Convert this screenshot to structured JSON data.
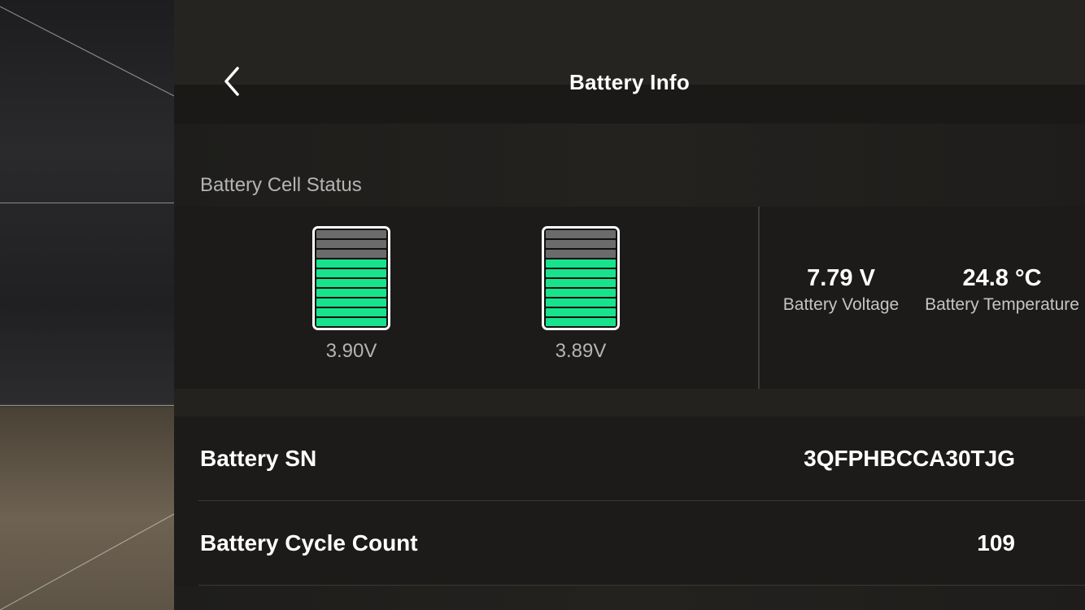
{
  "header": {
    "title": "Battery Info",
    "back_icon": "chevron-left-icon"
  },
  "cell_status": {
    "label": "Battery Cell Status",
    "cells": [
      {
        "voltage": "3.90V",
        "level_segments": 7,
        "total_segments": 10
      },
      {
        "voltage": "3.89V",
        "level_segments": 7,
        "total_segments": 10
      }
    ]
  },
  "stats": {
    "voltage": {
      "value": "7.79 V",
      "label": "Battery Voltage"
    },
    "temperature": {
      "value": "24.8 °C",
      "label": "Battery Temperature"
    }
  },
  "info_rows": [
    {
      "key": "Battery SN",
      "value": "3QFPHBCCA30TJG"
    },
    {
      "key": "Battery Cycle Count",
      "value": "109"
    }
  ],
  "colors": {
    "cell_full": "#16e38c",
    "cell_empty": "#6b6b6b",
    "panel_bg": "#1c1b19"
  }
}
